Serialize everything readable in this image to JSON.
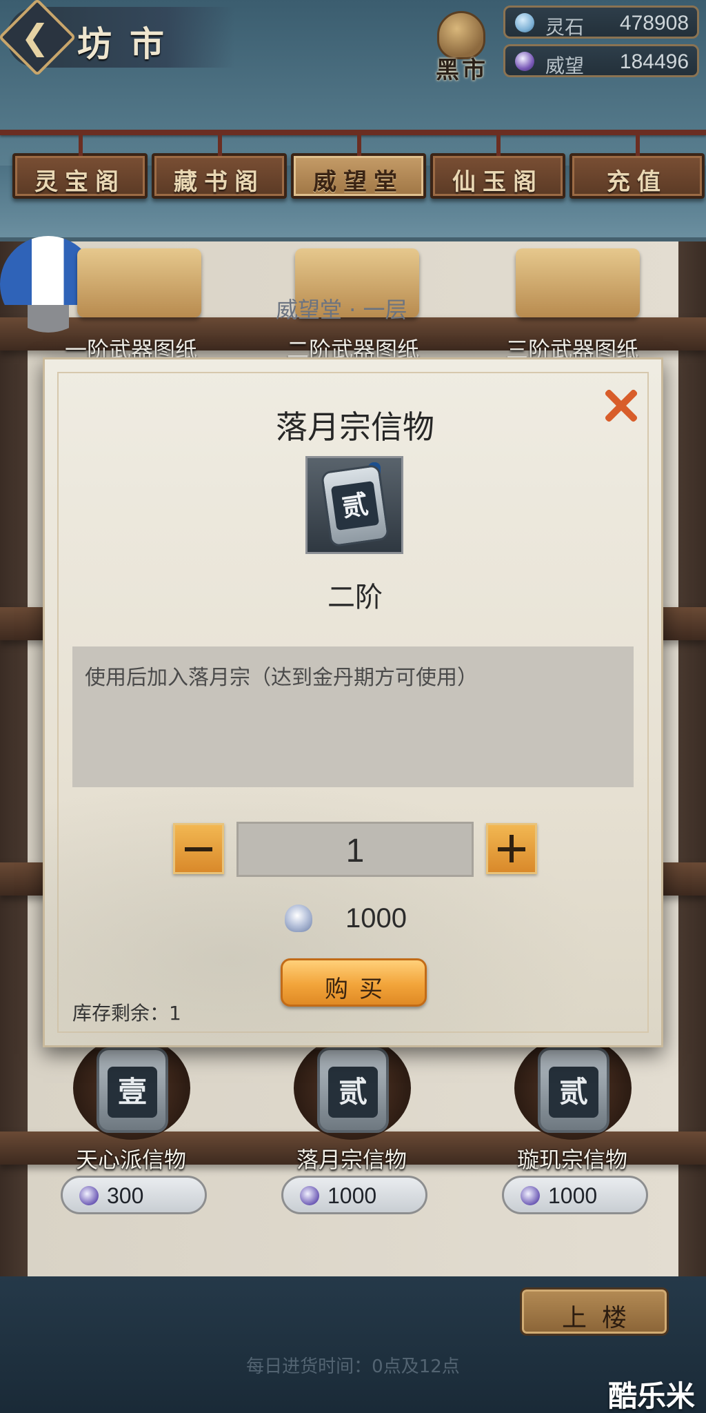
{
  "header": {
    "title": "坊市",
    "back_icon": "chevron-left-icon",
    "black_market": "黑市"
  },
  "currencies": [
    {
      "label": "灵石",
      "value": "478908",
      "icon": "spirit-stone-icon",
      "color": "#7fb2d6"
    },
    {
      "label": "威望",
      "value": "184496",
      "icon": "prestige-icon",
      "color": "#7a5ab8"
    }
  ],
  "tabs": [
    {
      "label": "灵宝阁",
      "active": false
    },
    {
      "label": "藏书阁",
      "active": false
    },
    {
      "label": "威望堂",
      "active": true
    },
    {
      "label": "仙玉阁",
      "active": false
    },
    {
      "label": "充值",
      "active": false
    }
  ],
  "floor_title": "威望堂 · 一层",
  "top_items": [
    {
      "name": "一阶武器图纸"
    },
    {
      "name": "二阶武器图纸"
    },
    {
      "name": "三阶武器图纸"
    }
  ],
  "bottom_items": [
    {
      "name": "天心派信物",
      "glyph": "壹",
      "price": "300"
    },
    {
      "name": "落月宗信物",
      "glyph": "贰",
      "price": "1000"
    },
    {
      "name": "璇玑宗信物",
      "glyph": "贰",
      "price": "1000"
    }
  ],
  "upstairs_label": "上楼",
  "restock_note": "每日进货时间：0点及12点",
  "watermark": "酷乐米",
  "modal": {
    "title": "落月宗信物",
    "icon_glyph": "贰",
    "tier": "二阶",
    "description": "使用后加入落月宗（达到金丹期方可使用）",
    "quantity": "1",
    "cost": "1000",
    "cost_icon": "prestige-icon",
    "buy_label": "购买",
    "stock_text": "库存剩余：1",
    "close_icon": "close-icon",
    "accent_color": "#d85d2a"
  }
}
